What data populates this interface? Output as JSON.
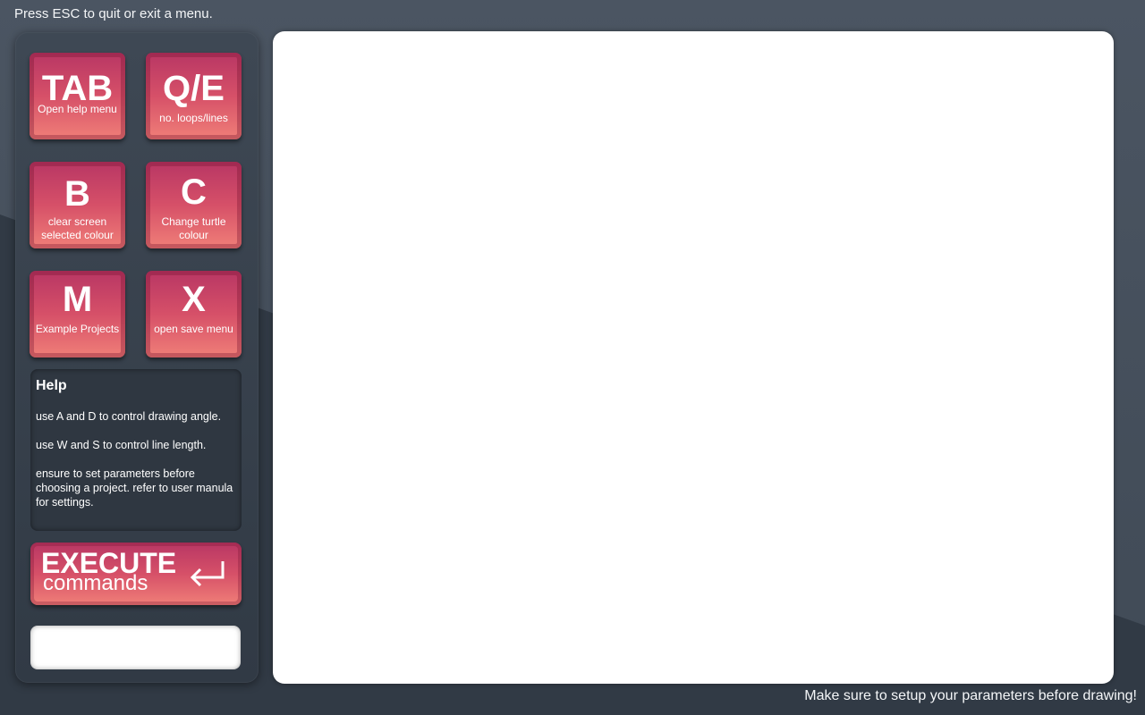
{
  "hints": {
    "top": "Press ESC to quit or exit a menu.",
    "bottom": "Make sure to setup your parameters before drawing!"
  },
  "keys": [
    {
      "letter": "TAB",
      "desc": "Open help menu"
    },
    {
      "letter": "Q/E",
      "desc": "no. loops/lines"
    },
    {
      "letter": "B",
      "desc": "clear screen selected colour"
    },
    {
      "letter": "C",
      "desc": "Change turtle colour"
    },
    {
      "letter": "M",
      "desc": "Example Projects"
    },
    {
      "letter": "X",
      "desc": "open save menu"
    }
  ],
  "help": {
    "title": "Help",
    "lines": [
      "use A and D to control drawing angle.",
      "use W and S to control line length.",
      "ensure to set parameters before choosing a project. refer to user manula for settings."
    ]
  },
  "execute": {
    "main": "EXECUTE",
    "sub": "commands",
    "icon": "return-arrow-icon"
  },
  "command_input": {
    "value": "",
    "placeholder": ""
  },
  "colors": {
    "key_top": "#b83664",
    "key_bottom": "#f07f78",
    "panel": "#313a45",
    "background": "#404a56",
    "canvas": "#ffffff"
  }
}
